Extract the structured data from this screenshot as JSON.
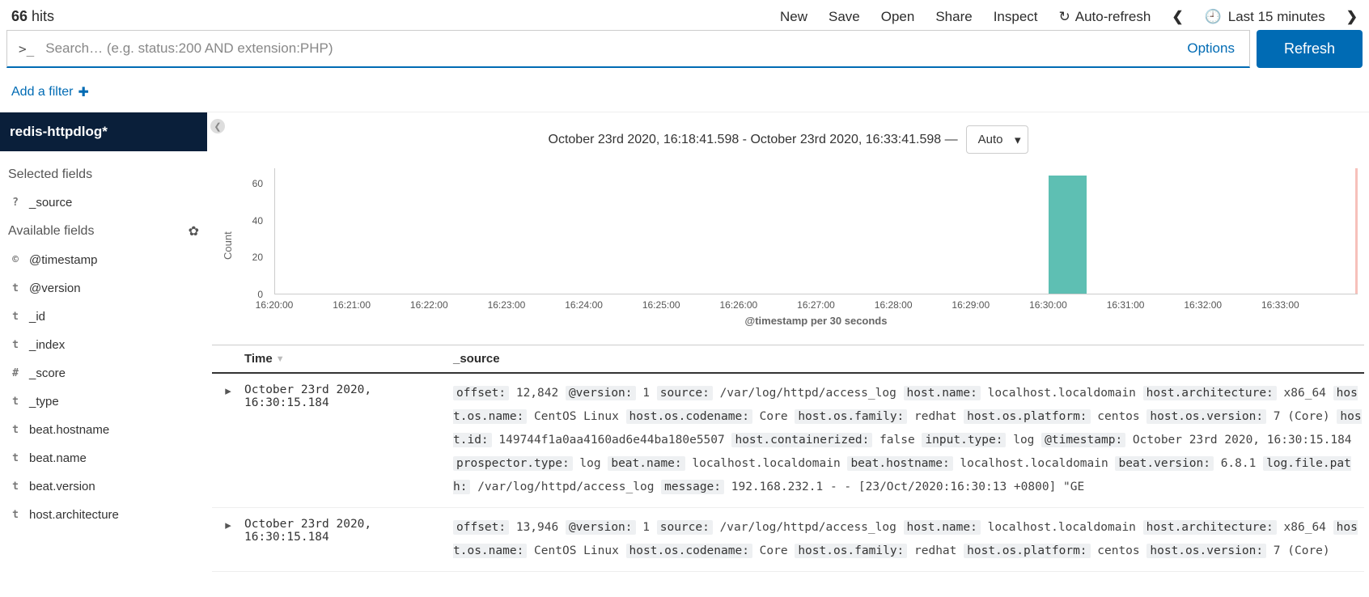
{
  "hits_count": "66",
  "hits_label": "hits",
  "topnav": {
    "new": "New",
    "save": "Save",
    "open": "Open",
    "share": "Share",
    "inspect": "Inspect",
    "autorefresh": "Auto-refresh",
    "timerange": "Last 15 minutes"
  },
  "query": {
    "prompt": ">_",
    "placeholder": "Search… (e.g. status:200 AND extension:PHP)",
    "options": "Options",
    "refresh": "Refresh"
  },
  "filterbar": {
    "add": "Add a filter"
  },
  "sidebar": {
    "index_pattern": "redis-httpdlog*",
    "selected_label": "Selected fields",
    "available_label": "Available fields",
    "selected": [
      {
        "type": "?",
        "name": "_source"
      }
    ],
    "available": [
      {
        "type": "©",
        "name": "@timestamp"
      },
      {
        "type": "t",
        "name": "@version"
      },
      {
        "type": "t",
        "name": "_id"
      },
      {
        "type": "t",
        "name": "_index"
      },
      {
        "type": "#",
        "name": "_score"
      },
      {
        "type": "t",
        "name": "_type"
      },
      {
        "type": "t",
        "name": "beat.hostname"
      },
      {
        "type": "t",
        "name": "beat.name"
      },
      {
        "type": "t",
        "name": "beat.version"
      },
      {
        "type": "t",
        "name": "host.architecture"
      }
    ]
  },
  "timelabel": "October 23rd 2020, 16:18:41.598 - October 23rd 2020, 16:33:41.598 —",
  "interval": "Auto",
  "chart_data": {
    "type": "bar",
    "title": "",
    "xlabel": "@timestamp per 30 seconds",
    "ylabel": "Count",
    "ylim": [
      0,
      70
    ],
    "yticks": [
      0,
      20,
      40,
      60
    ],
    "categories": [
      "16:20:00",
      "16:21:00",
      "16:22:00",
      "16:23:00",
      "16:24:00",
      "16:25:00",
      "16:26:00",
      "16:27:00",
      "16:28:00",
      "16:29:00",
      "16:30:00",
      "16:31:00",
      "16:32:00",
      "16:33:00"
    ],
    "values": [
      0,
      0,
      0,
      0,
      0,
      0,
      0,
      0,
      0,
      0,
      66,
      0,
      0,
      0
    ]
  },
  "table": {
    "time_header": "Time",
    "source_header": "_source",
    "rows": [
      {
        "time": "October 23rd 2020, 16:30:15.184",
        "fields": [
          {
            "k": "offset:",
            "v": "12,842"
          },
          {
            "k": "@version:",
            "v": "1"
          },
          {
            "k": "source:",
            "v": "/var/log/httpd/access_log"
          },
          {
            "k": "host.name:",
            "v": "localhost.localdomain"
          },
          {
            "k": "host.architecture:",
            "v": "x86_64"
          },
          {
            "k": "host.os.name:",
            "v": "CentOS Linux"
          },
          {
            "k": "host.os.codename:",
            "v": "Core"
          },
          {
            "k": "host.os.family:",
            "v": "redhat"
          },
          {
            "k": "host.os.platform:",
            "v": "centos"
          },
          {
            "k": "host.os.version:",
            "v": "7 (Core)"
          },
          {
            "k": "host.id:",
            "v": "149744f1a0aa4160ad6e44ba180e5507"
          },
          {
            "k": "host.containerized:",
            "v": "false"
          },
          {
            "k": "input.type:",
            "v": "log"
          },
          {
            "k": "@timestamp:",
            "v": "October 23rd 2020, 16:30:15.184"
          },
          {
            "k": "prospector.type:",
            "v": "log"
          },
          {
            "k": "beat.name:",
            "v": "localhost.localdomain"
          },
          {
            "k": "beat.hostname:",
            "v": "localhost.localdomain"
          },
          {
            "k": "beat.version:",
            "v": "6.8.1"
          },
          {
            "k": "log.file.path:",
            "v": "/var/log/httpd/access_log"
          },
          {
            "k": "message:",
            "v": "192.168.232.1 - - [23/Oct/2020:16:30:13 +0800] \"GE"
          }
        ]
      },
      {
        "time": "October 23rd 2020, 16:30:15.184",
        "fields": [
          {
            "k": "offset:",
            "v": "13,946"
          },
          {
            "k": "@version:",
            "v": "1"
          },
          {
            "k": "source:",
            "v": "/var/log/httpd/access_log"
          },
          {
            "k": "host.name:",
            "v": "localhost.localdomain"
          },
          {
            "k": "host.architecture:",
            "v": "x86_64"
          },
          {
            "k": "host.os.name:",
            "v": "CentOS Linux"
          },
          {
            "k": "host.os.codename:",
            "v": "Core"
          },
          {
            "k": "host.os.family:",
            "v": "redhat"
          },
          {
            "k": "host.os.platform:",
            "v": "centos"
          },
          {
            "k": "host.os.version:",
            "v": "7 (Core)"
          }
        ]
      }
    ]
  }
}
